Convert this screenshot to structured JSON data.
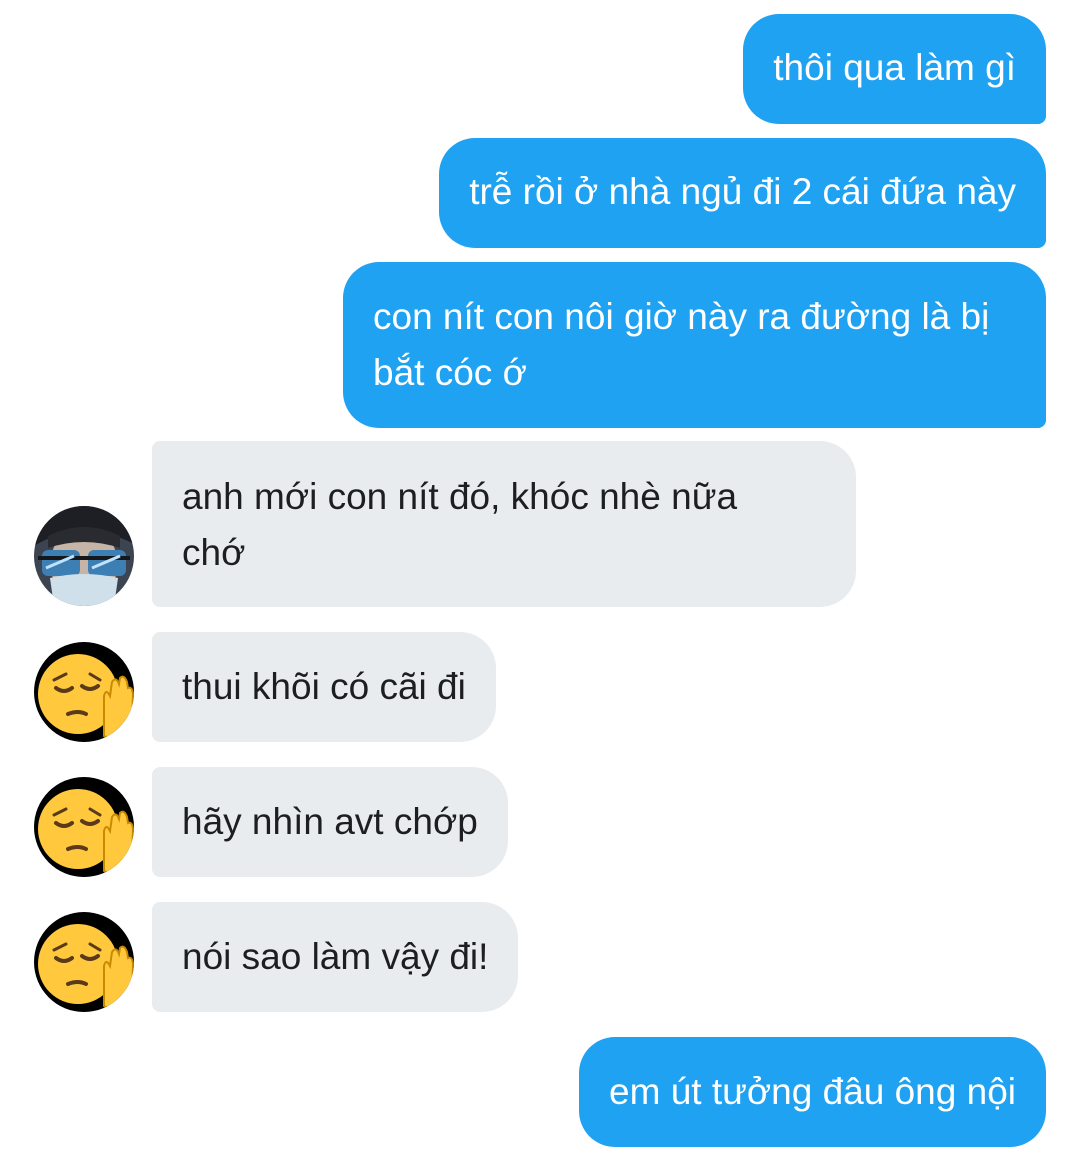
{
  "messages": [
    {
      "side": "out",
      "text": "thôi qua làm gì"
    },
    {
      "side": "out",
      "text": "trễ rồi ở nhà ngủ đi 2 cái đứa này"
    },
    {
      "side": "out",
      "text_line1": "con nít con nôi giờ này ra đường là bị",
      "text_line2": "bắt cóc ớ"
    },
    {
      "side": "in",
      "avatar": "sunglasses-mask-photo-avatar",
      "text_line1": "anh mới con nít đó, khóc nhè nữa",
      "text_line2": "chớ"
    },
    {
      "side": "in",
      "avatar": "pensive-face-raised-hand-emoji",
      "text": "thui khõi có cãi đi"
    },
    {
      "side": "in",
      "avatar": "pensive-face-raised-hand-emoji",
      "text": "hãy nhìn avt chớp"
    },
    {
      "side": "in",
      "avatar": "pensive-face-raised-hand-emoji",
      "text": "nói sao làm vậy đi!"
    },
    {
      "side": "out",
      "text": "em út tưởng đâu ông nội"
    }
  ],
  "colors": {
    "outgoing_bubble": "#20a2f3",
    "incoming_bubble": "#e9ecef",
    "outgoing_text": "#ffffff",
    "incoming_text": "#1c1e21"
  }
}
